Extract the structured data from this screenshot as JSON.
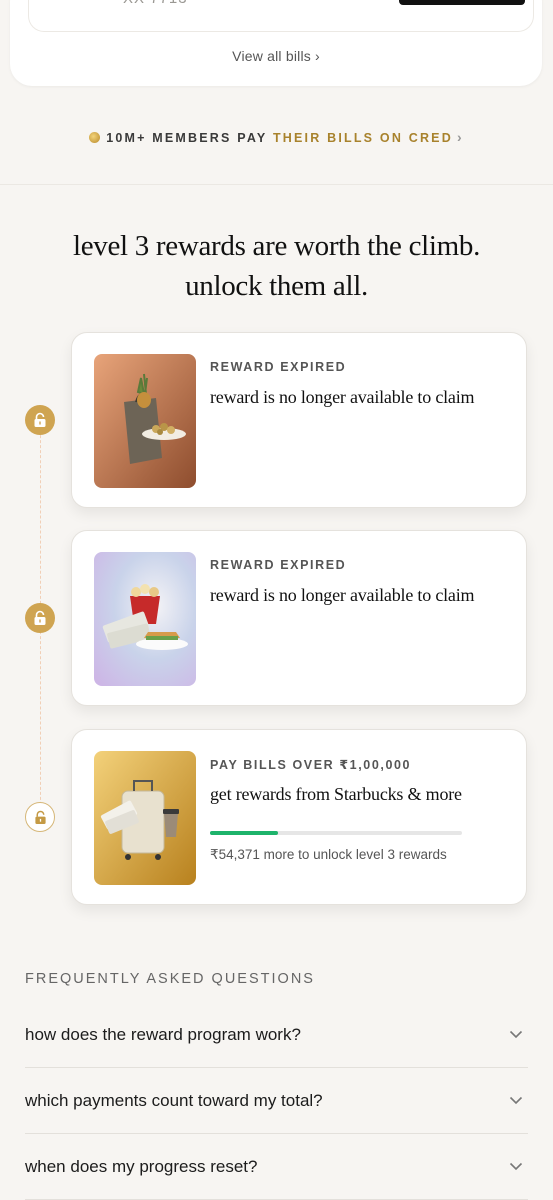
{
  "top_card": {
    "account_partial": "XX 7713",
    "view_all_label": "View all bills",
    "view_all_chevron": "›"
  },
  "members_banner": {
    "icon": "coin-icon",
    "text_plain": "10M+ MEMBERS PAY",
    "text_gold": "THEIR BILLS ON CRED",
    "chevron": "›",
    "accent_color": "#a8822c"
  },
  "headline": {
    "line1": "level 3 rewards are worth the climb.",
    "line2": "unlock them all."
  },
  "rewards": [
    {
      "status": "locked",
      "label": "REWARD EXPIRED",
      "description": "reward is no longer available to claim",
      "image": "popcorn-shopping-bag-image"
    },
    {
      "status": "locked",
      "label": "REWARD EXPIRED",
      "description": "reward is no longer available to claim",
      "image": "movie-tickets-popcorn-sandwich-image"
    },
    {
      "status": "in-progress",
      "label": "PAY BILLS OVER ₹1,00,000",
      "description": "get rewards from Starbucks & more",
      "image": "travel-suitcase-coffee-image",
      "progress_fraction": 0.27,
      "progress_text": "₹54,371 more to unlock level 3 rewards",
      "progress_color": "#1db36b"
    }
  ],
  "faq": {
    "title": "FREQUENTLY ASKED QUESTIONS",
    "items": [
      {
        "question": "how does the reward program work?"
      },
      {
        "question": "which payments count toward my total?"
      },
      {
        "question": "when does my progress reset?"
      }
    ]
  },
  "colors": {
    "background": "#f7f5f2",
    "lock_gold": "#cfa451",
    "card": "#ffffff"
  }
}
